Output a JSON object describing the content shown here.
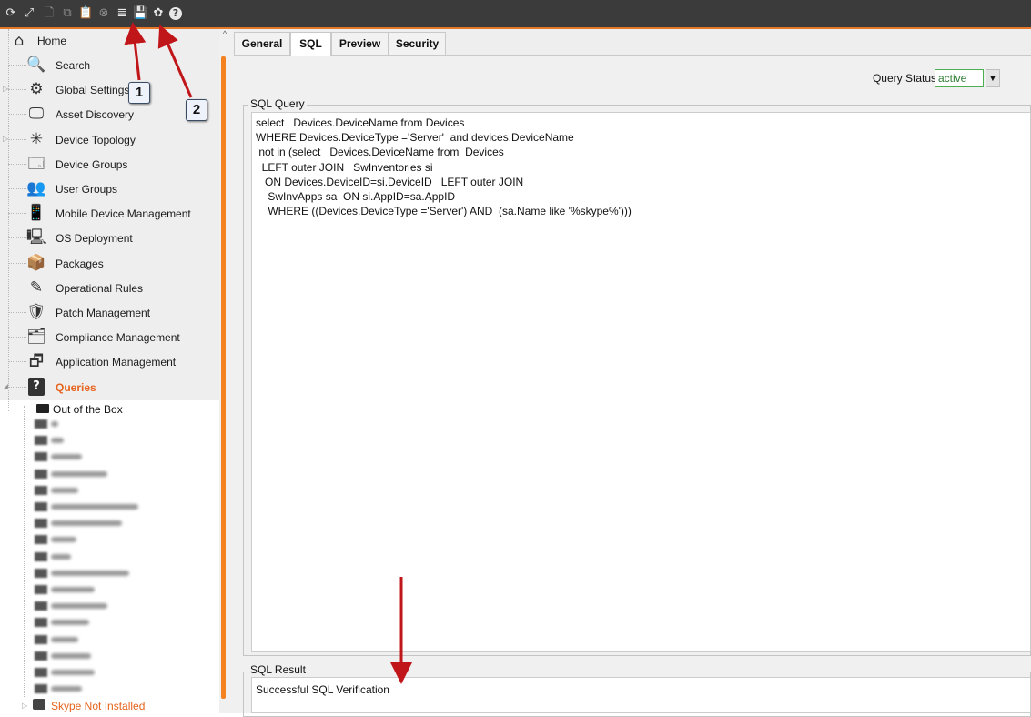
{
  "toolbar": {
    "icons": [
      {
        "name": "refresh-icon",
        "glyph": "⟳",
        "dim": false
      },
      {
        "name": "expand-icon",
        "glyph": "⤢",
        "dim": false
      },
      {
        "name": "new-document-icon",
        "glyph": "🗋",
        "dim": true
      },
      {
        "name": "copy-icon",
        "glyph": "⧉",
        "dim": true
      },
      {
        "name": "paste-icon",
        "glyph": "📋",
        "dim": true
      },
      {
        "name": "cancel-icon",
        "glyph": "⊗",
        "dim": true
      },
      {
        "name": "sql-verify-icon",
        "glyph": "≣",
        "dim": false
      },
      {
        "name": "sql-save-icon",
        "glyph": "💾",
        "dim": false
      },
      {
        "name": "settings-icon",
        "glyph": "✿",
        "dim": false
      },
      {
        "name": "help-icon",
        "glyph": "?",
        "dim": false
      }
    ]
  },
  "sidebar": {
    "home_label": "Home",
    "items": [
      {
        "label": "Search",
        "icon": "search-icon",
        "glyph": "🔍",
        "expandable": false
      },
      {
        "label": "Global Settings",
        "icon": "gears-icon",
        "glyph": "⚙",
        "expandable": true
      },
      {
        "label": "Asset Discovery",
        "icon": "asset-discovery-icon",
        "glyph": "🖵",
        "expandable": false
      },
      {
        "label": "Device Topology",
        "icon": "topology-icon",
        "glyph": "✳",
        "expandable": true
      },
      {
        "label": "Device Groups",
        "icon": "device-groups-icon",
        "glyph": "🗔",
        "expandable": false
      },
      {
        "label": "User Groups",
        "icon": "user-groups-icon",
        "glyph": "👥",
        "expandable": false
      },
      {
        "label": "Mobile Device Management",
        "icon": "mobile-device-icon",
        "glyph": "📱",
        "expandable": false
      },
      {
        "label": "OS Deployment",
        "icon": "os-deployment-icon",
        "glyph": "🖳",
        "expandable": false
      },
      {
        "label": "Packages",
        "icon": "packages-icon",
        "glyph": "📦",
        "expandable": false
      },
      {
        "label": "Operational Rules",
        "icon": "operational-rules-icon",
        "glyph": "✎",
        "expandable": false
      },
      {
        "label": "Patch Management",
        "icon": "patch-shield-icon",
        "glyph": "🛡",
        "expandable": false
      },
      {
        "label": "Compliance Management",
        "icon": "compliance-icon",
        "glyph": "🗂",
        "expandable": false
      },
      {
        "label": "Application Management",
        "icon": "application-icon",
        "glyph": "🗗",
        "expandable": false
      },
      {
        "label": "Queries",
        "icon": "queries-icon",
        "glyph": "?",
        "expandable": true,
        "active": true
      }
    ],
    "folder_label": "Out of the Box",
    "skype_label": "Skype Not Installed"
  },
  "tabs": [
    {
      "label": "General",
      "active": false
    },
    {
      "label": "SQL",
      "active": true
    },
    {
      "label": "Preview",
      "active": false
    },
    {
      "label": "Security",
      "active": false
    }
  ],
  "query_status": {
    "label": "Query Status",
    "value": "active"
  },
  "sql_query": {
    "title": "SQL Query",
    "lines": [
      "select   Devices.DeviceName from Devices",
      "WHERE Devices.DeviceType ='Server'  and devices.DeviceName",
      " not in (select   Devices.DeviceName from  Devices",
      "  LEFT outer JOIN   SwInventories si",
      "   ON Devices.DeviceID=si.DeviceID   LEFT outer JOIN",
      "    SwInvApps sa  ON si.AppID=sa.AppID",
      "    WHERE ((Devices.DeviceType ='Server') AND  (sa.Name like '%skype%')))"
    ]
  },
  "sql_result": {
    "title": "SQL Result",
    "text": "Successful SQL Verification"
  },
  "annotations": {
    "callout_1": "1",
    "callout_2": "2",
    "arrow_color": "#c0161a"
  }
}
